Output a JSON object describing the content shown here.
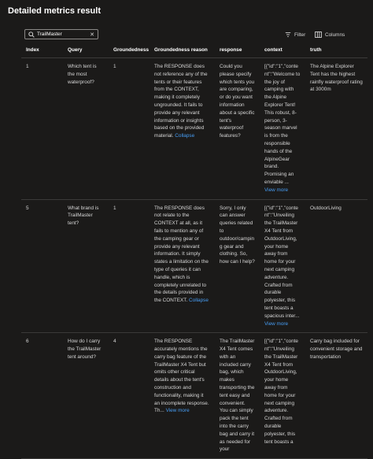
{
  "page_title": "Detailed metrics result",
  "search": {
    "value": "TrailMaster",
    "clear_glyph": "✕"
  },
  "toolbar": {
    "filter_label": "Filter",
    "columns_label": "Columns"
  },
  "icons": {
    "search": "search-icon",
    "clear": "close-icon",
    "filter": "filter-icon",
    "columns": "columns-icon"
  },
  "colors": {
    "background": "#1b1a19",
    "link": "#479ef5",
    "border": "#3b3a39"
  },
  "table": {
    "headers": [
      "Index",
      "Query",
      "Groundedness",
      "Groundedness reason",
      "response",
      "context",
      "truth"
    ],
    "rows": [
      {
        "index": "1",
        "query": "Which tent is the most waterproof?",
        "groundedness": "1",
        "reason": "The RESPONSE does not reference any of the tents or their features from the CONTEXT, making it completely ungrounded. It fails to provide any relevant information or insights based on the provided material.",
        "reason_link": "Collapse",
        "response": "Could you please specify which tents you are comparing, or do you want information about a specific tent's waterproof features?",
        "context": "[{\"id\":\"1\",\"content\":\"Welcome to the joy of camping with the Alpine Explorer Tent! This robust, 8-person, 3-season marvel is from the responsible hands of the AlpineGear brand. Promising an enviable ...",
        "context_link": "View more",
        "truth": "The Alpine Explorer Tent has the highest rainfly waterproof rating at 3000m"
      },
      {
        "index": "5",
        "query": "What brand is TrailMaster tent?",
        "groundedness": "1",
        "reason": "The RESPONSE does not relate to the CONTEXT at all, as it fails to mention any of the camping gear or provide any relevant information. It simply states a limitation on the type of queries it can handle, which is completely unrelated to the details provided in the CONTEXT.",
        "reason_link": "Collapse",
        "response": "Sorry, I only can answer queries related to outdoor/camping gear and clothing. So, how can I help?",
        "context": "[{\"id\":\"1\",\"content\":\"Unveiling the TrailMaster X4 Tent from OutdoorLiving, your home away from home for your next camping adventure. Crafted from durable polyester, this tent boasts a spacious inter...",
        "context_link": "View more",
        "truth": "OutdoorLiving"
      },
      {
        "index": "6",
        "query": "How do I carry the TrailMaster tent around?",
        "groundedness": "4",
        "reason": "The RESPONSE accurately mentions the carry bag feature of the TrailMaster X4 Tent but omits other critical details about the tent's construction and functionality, making it an incomplete response. Th...",
        "reason_link": "View more",
        "response": "The TrailMaster X4 Tent comes with an included carry bag, which makes transporting the tent easy and convenient. You can simply pack the tent into the carry bag and carry it as needed for your",
        "context": "[{\"id\":\"1\",\"content\":\"Unveiling the TrailMaster X4 Tent from OutdoorLiving, your home away from home for your next camping adventure. Crafted from durable polyester, this tent boasts a",
        "context_link": "",
        "truth": "Carry bag included for convenient storage and transportation"
      }
    ]
  }
}
